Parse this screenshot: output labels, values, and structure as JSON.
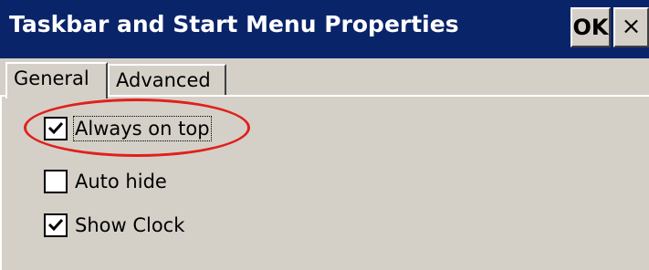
{
  "window": {
    "title": "Taskbar and Start Menu Properties",
    "ok_label": "OK",
    "close_label": "×"
  },
  "tabs": [
    {
      "label": "General",
      "selected": true
    },
    {
      "label": "Advanced",
      "selected": false
    }
  ],
  "options": [
    {
      "label": "Always on top",
      "checked": true
    },
    {
      "label": "Auto hide",
      "checked": false
    },
    {
      "label": "Show Clock",
      "checked": true
    }
  ],
  "colors": {
    "titlebar": "#0a246a",
    "face": "#d4d0c8",
    "annotation": "#e0201c"
  }
}
